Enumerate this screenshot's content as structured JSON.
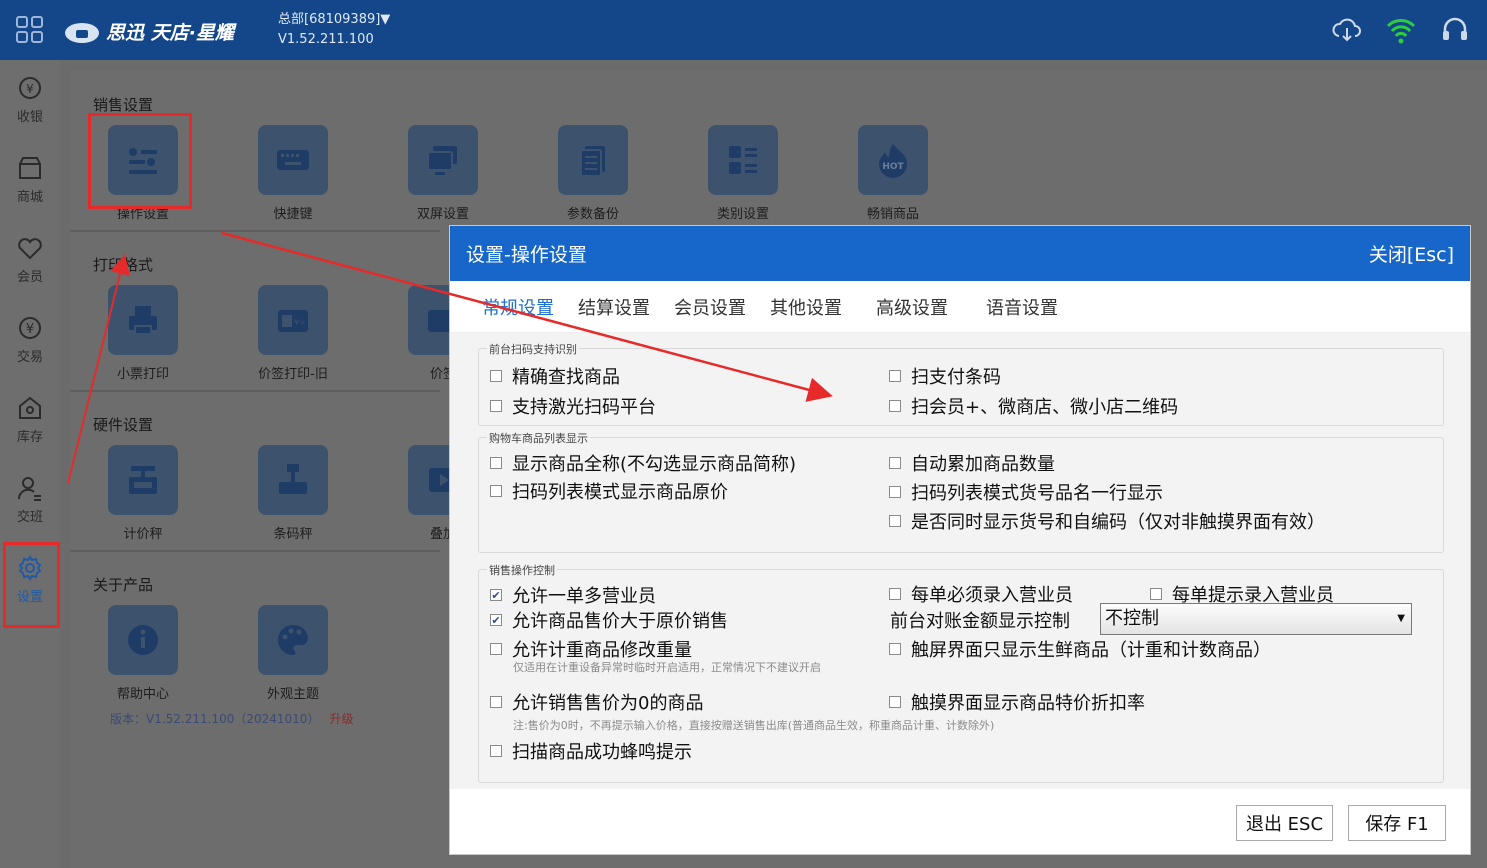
{
  "topbar": {
    "logo_text": "思迅 天店·星耀",
    "branch": "总部[68109389]▼",
    "version": "V1.52.211.100",
    "icons": [
      "grid-icon",
      "cloud-sync-icon",
      "wifi-icon",
      "headset-icon"
    ]
  },
  "sidebar": {
    "items": [
      {
        "label": "收银",
        "icon": "cashier-icon"
      },
      {
        "label": "商城",
        "icon": "store-icon"
      },
      {
        "label": "会员",
        "icon": "member-icon"
      },
      {
        "label": "交易",
        "icon": "yen-icon"
      },
      {
        "label": "库存",
        "icon": "inventory-icon"
      },
      {
        "label": "交班",
        "icon": "shift-icon"
      },
      {
        "label": "设置",
        "icon": "gear-icon"
      }
    ]
  },
  "main": {
    "sections": {
      "sales": "销售设置",
      "print": "打印格式",
      "hardware": "硬件设置",
      "about": "关于产品"
    },
    "sales_tiles": [
      "操作设置",
      "快捷键",
      "双屏设置",
      "参数备份",
      "类别设置",
      "畅销商品"
    ],
    "print_tiles": [
      "小票打印",
      "价签打印-旧",
      "价签"
    ],
    "hardware_tiles": [
      "计价秤",
      "条码秤",
      "叠加"
    ],
    "about_tiles": [
      "帮助中心",
      "外观主题"
    ],
    "version_text": "版本：V1.52.211.100（20241010）",
    "upgrade": "升级"
  },
  "dialog": {
    "title": "设置-操作设置",
    "close": "关闭[Esc]",
    "tabs": [
      "常规设置",
      "结算设置",
      "会员设置",
      "其他设置",
      "高级设置",
      "语音设置"
    ],
    "groups": {
      "scan": {
        "title": "前台扫码支持识别",
        "options": [
          {
            "label": "精确查找商品",
            "checked": false
          },
          {
            "label": "扫支付条码",
            "checked": false
          },
          {
            "label": "支持激光扫码平台",
            "checked": false
          },
          {
            "label": "扫会员+、微商店、微小店二维码",
            "checked": false
          }
        ]
      },
      "cart": {
        "title": "购物车商品列表显示",
        "options": [
          {
            "label": "显示商品全称(不勾选显示商品简称)",
            "checked": false
          },
          {
            "label": "自动累加商品数量",
            "checked": false
          },
          {
            "label": "扫码列表模式显示商品原价",
            "checked": false
          },
          {
            "label": "扫码列表模式货号品名一行显示",
            "checked": false
          },
          {
            "label": "是否同时显示货号和自编码（仅对非触摸界面有效）",
            "checked": false
          }
        ]
      },
      "sales": {
        "title": "销售操作控制",
        "options": [
          {
            "label": "允许一单多营业员",
            "checked": true
          },
          {
            "label": "每单必须录入营业员",
            "checked": false
          },
          {
            "label": "每单提示录入营业员",
            "checked": false
          },
          {
            "label": "允许商品售价大于原价销售",
            "checked": true
          },
          {
            "label": "允许计重商品修改重量",
            "checked": false
          },
          {
            "label": "触屏界面只显示生鲜商品（计重和计数商品）",
            "checked": false
          },
          {
            "label": "允许销售售价为0的商品",
            "checked": false
          },
          {
            "label": "触摸界面显示商品特价折扣率",
            "checked": false
          },
          {
            "label": "扫描商品成功蜂鸣提示",
            "checked": false
          }
        ],
        "amount_label": "前台对账金额显示控制",
        "amount_value": "不控制",
        "hint_weight": "仅适用在计重设备异常时临时开启适用，正常情况下不建议开启",
        "hint_zero": "注:售价为0时，不再提示输入价格，直接按赠送销售出库(普通商品生效，称重商品计重、计数除外)"
      }
    },
    "buttons": {
      "exit": "退出 ESC",
      "save": "保存 F1"
    }
  },
  "colors": {
    "topbar": "#134789",
    "dialog_header": "#1766c9",
    "tab_active": "#1c6fd1",
    "annotation_red": "#e62a2a"
  }
}
